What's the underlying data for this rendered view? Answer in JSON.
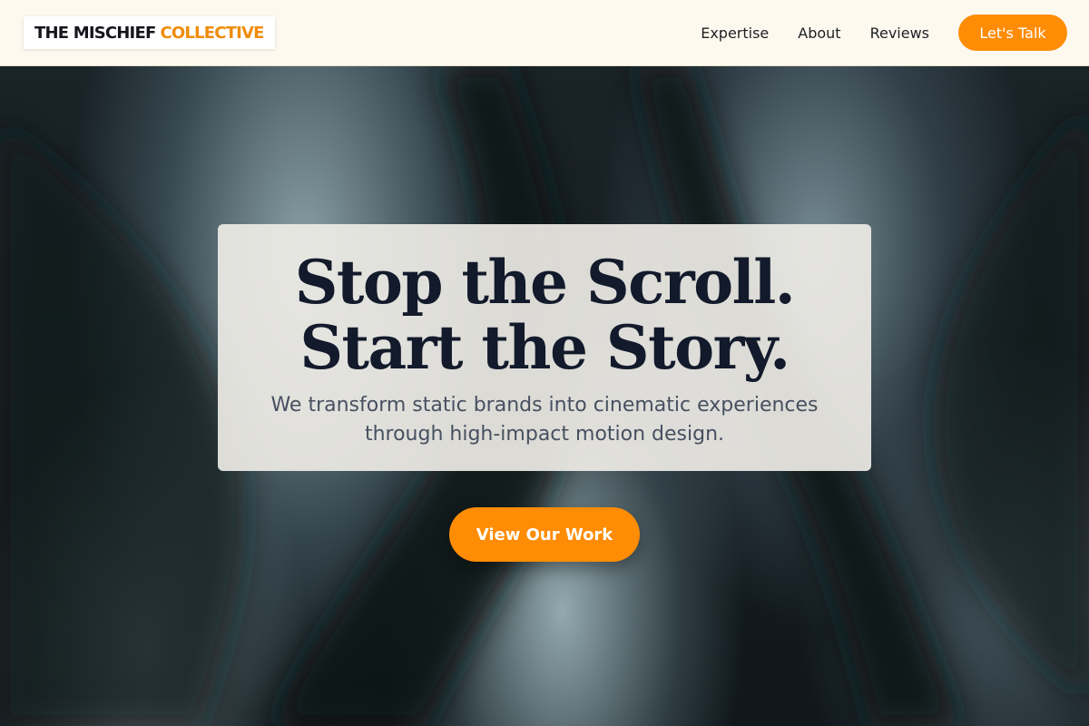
{
  "header": {
    "logo_part1": "THE MISCHIEF",
    "logo_part2": "COLLECTIVE",
    "nav": [
      {
        "label": "Expertise"
      },
      {
        "label": "About"
      },
      {
        "label": "Reviews"
      }
    ],
    "cta_label": "Let's Talk"
  },
  "hero": {
    "headline_line1": "Stop the Scroll.",
    "headline_line2": "Start the Story.",
    "subtext": "We transform static brands into cinematic experiences through high-impact motion design.",
    "button_label": "View Our Work"
  },
  "colors": {
    "accent": "#ff8c05",
    "header_bg": "#fdf9ee",
    "headline": "#121a2b",
    "subtext": "#475060"
  }
}
